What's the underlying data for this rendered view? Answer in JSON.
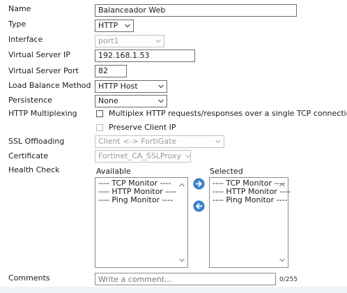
{
  "labels": {
    "name": "Name",
    "type": "Type",
    "interface": "Interface",
    "virtual_server_ip": "Virtual Server IP",
    "virtual_server_port": "Virtual Server Port",
    "load_balance_method": "Load Balance Method",
    "persistence": "Persistence",
    "http_multiplexing": "HTTP Multiplexing",
    "ssl_offloading": "SSL Offloading",
    "certificate": "Certificate",
    "health_check": "Health Check",
    "comments": "Comments"
  },
  "fields": {
    "name_value": "Balanceador Web",
    "type_value": "HTTP",
    "interface_value": "port1",
    "virtual_server_ip_value": "192.168.1.53",
    "virtual_server_port_value": "82",
    "load_balance_method_value": "HTTP Host",
    "persistence_value": "None",
    "ssl_offloading_value": "Client <-> FortiGate",
    "certificate_value": "Fortinet_CA_SSLProxy",
    "comments_placeholder": "Write a comment...",
    "comments_counter": "0/255"
  },
  "checkboxes": {
    "multiplex_label": "Multiplex HTTP requests/responses over a single TCP connection",
    "multiplex_checked": false,
    "preserve_ip_label": "Preserve Client IP",
    "preserve_ip_checked": false
  },
  "health_check": {
    "available_label": "Available",
    "selected_label": "Selected",
    "available_items": [
      "---- TCP Monitor ----",
      "---- HTTP Monitor ----",
      "---- Ping Monitor ----"
    ],
    "selected_items": [
      "---- TCP Monitor ----",
      "---- HTTP Monitor ----",
      "---- Ping Monitor ----"
    ]
  },
  "icons": {
    "move_right": "arrow-right-circle-icon",
    "move_left": "arrow-left-circle-icon",
    "dropdown": "chevron-down-icon"
  },
  "colors": {
    "accent": "#3a86d4",
    "border": "#6b6b6b",
    "disabled_text": "#9a9a9a",
    "disabled_border": "#c2c2c2"
  }
}
